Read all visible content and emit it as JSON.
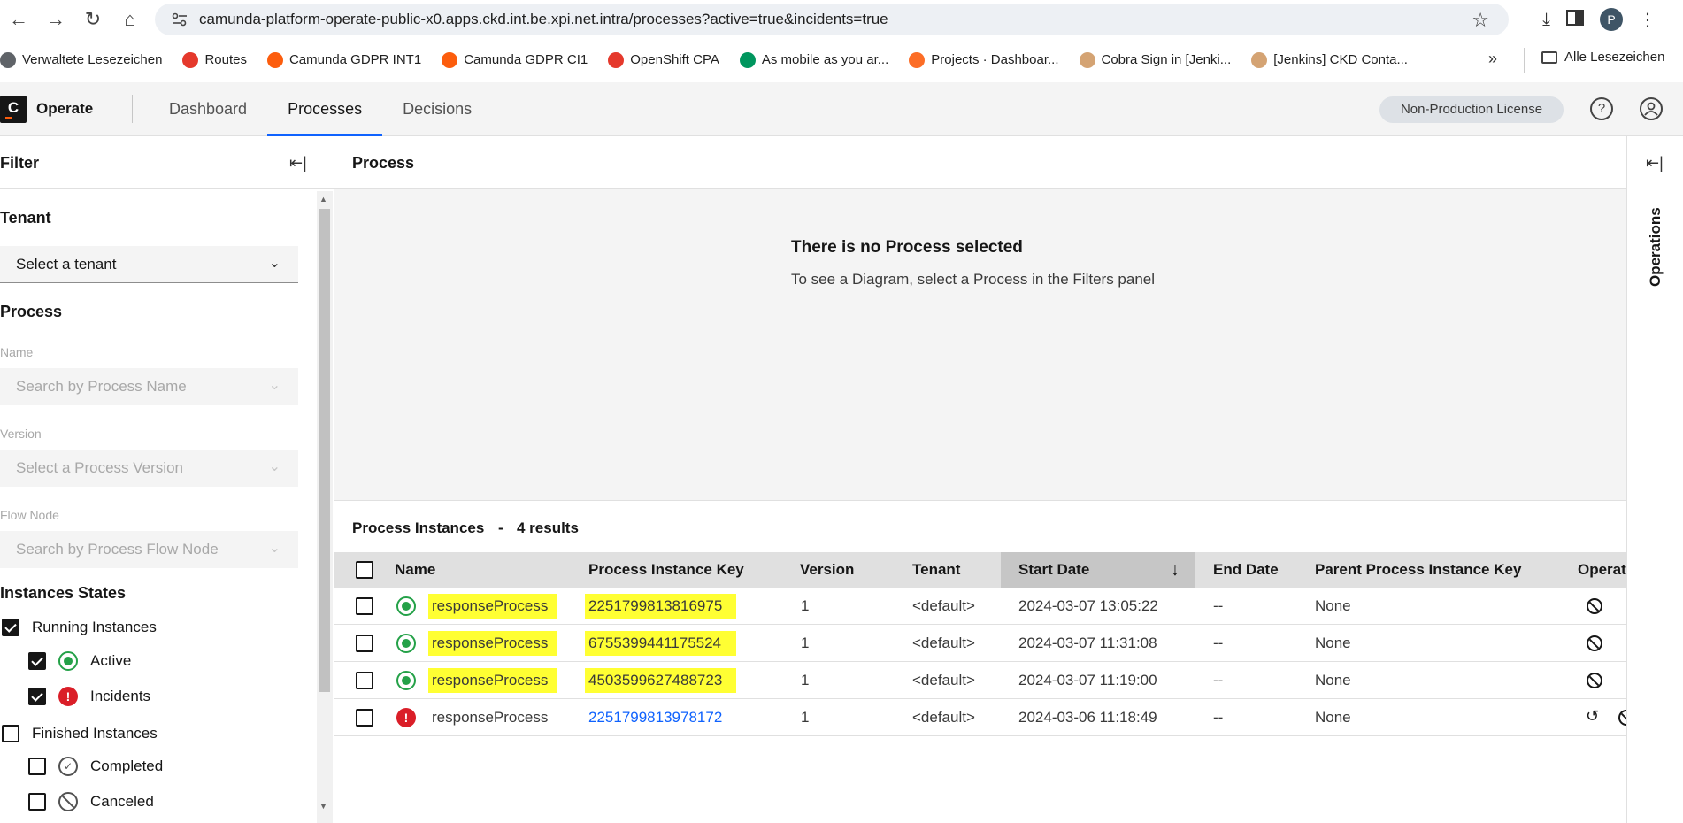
{
  "browser": {
    "url": "camunda-platform-operate-public-x0.apps.ckd.int.be.xpi.net.intra/processes?active=true&incidents=true",
    "profile_initial": "P",
    "bookmarks": [
      {
        "label": "Verwaltete Lesezeichen",
        "color": "#5f6368"
      },
      {
        "label": "Routes",
        "color": "#e5392c"
      },
      {
        "label": "Camunda GDPR INT1",
        "color": "#fc5d0d"
      },
      {
        "label": "Camunda GDPR CI1",
        "color": "#fc5d0d"
      },
      {
        "label": "OpenShift CPA",
        "color": "#e5392c"
      },
      {
        "label": "As mobile as you ar...",
        "color": "#00965e"
      },
      {
        "label": "Projects · Dashboar...",
        "color": "#fc6d26"
      },
      {
        "label": "Cobra Sign in [Jenki...",
        "color": "#d4a373"
      },
      {
        "label": "[Jenkins] CKD Conta...",
        "color": "#d4a373"
      }
    ],
    "all_bookmarks_label": "Alle Lesezeichen"
  },
  "header": {
    "logo_letter": "C",
    "app_name": "Operate",
    "tabs": [
      "Dashboard",
      "Processes",
      "Decisions"
    ],
    "active_tab": "Processes",
    "license": "Non-Production License"
  },
  "filters": {
    "title": "Filter",
    "tenant": {
      "title": "Tenant",
      "value": "Select a tenant"
    },
    "process": {
      "title": "Process",
      "name_label": "Name",
      "name_placeholder": "Search by Process Name",
      "version_label": "Version",
      "version_placeholder": "Select a Process Version",
      "flow_node_label": "Flow Node",
      "flow_node_placeholder": "Search by Process Flow Node"
    },
    "states": {
      "title": "Instances States",
      "running": {
        "label": "Running Instances",
        "checked": true
      },
      "active": {
        "label": "Active",
        "checked": true
      },
      "incidents": {
        "label": "Incidents",
        "checked": true
      },
      "finished": {
        "label": "Finished Instances",
        "checked": false
      },
      "completed": {
        "label": "Completed",
        "checked": false
      },
      "canceled": {
        "label": "Canceled",
        "checked": false
      }
    }
  },
  "diagram": {
    "title": "Process",
    "empty_title": "There is no Process selected",
    "empty_subtitle": "To see a Diagram, select a Process in the Filters panel"
  },
  "instances": {
    "title": "Process Instances",
    "separator": "-",
    "count": "4 results",
    "columns": [
      "Name",
      "Process Instance Key",
      "Version",
      "Tenant",
      "Start Date",
      "End Date",
      "Parent Process Instance Key",
      "Operat"
    ],
    "sorted_column": "Start Date",
    "rows": [
      {
        "state": "active",
        "name": "responseProcess",
        "key": "2251799813816975",
        "version": "1",
        "tenant": "<default>",
        "start": "2024-03-07 13:05:22",
        "end": "--",
        "parent": "None",
        "highlighted": true
      },
      {
        "state": "active",
        "name": "responseProcess",
        "key": "6755399441175524",
        "version": "1",
        "tenant": "<default>",
        "start": "2024-03-07 11:31:08",
        "end": "--",
        "parent": "None",
        "highlighted": true
      },
      {
        "state": "active",
        "name": "responseProcess",
        "key": "4503599627488723",
        "version": "1",
        "tenant": "<default>",
        "start": "2024-03-07 11:19:00",
        "end": "--",
        "parent": "None",
        "highlighted": true
      },
      {
        "state": "incident",
        "name": "responseProcess",
        "key": "2251799813978172",
        "version": "1",
        "tenant": "<default>",
        "start": "2024-03-06 11:18:49",
        "end": "--",
        "parent": "None",
        "highlighted": false
      }
    ]
  },
  "operations": {
    "label": "Operations"
  },
  "colors": {
    "accent": "#0f62fe",
    "active": "#24a148",
    "incident": "#da1e28",
    "highlight": "#ffff33"
  }
}
